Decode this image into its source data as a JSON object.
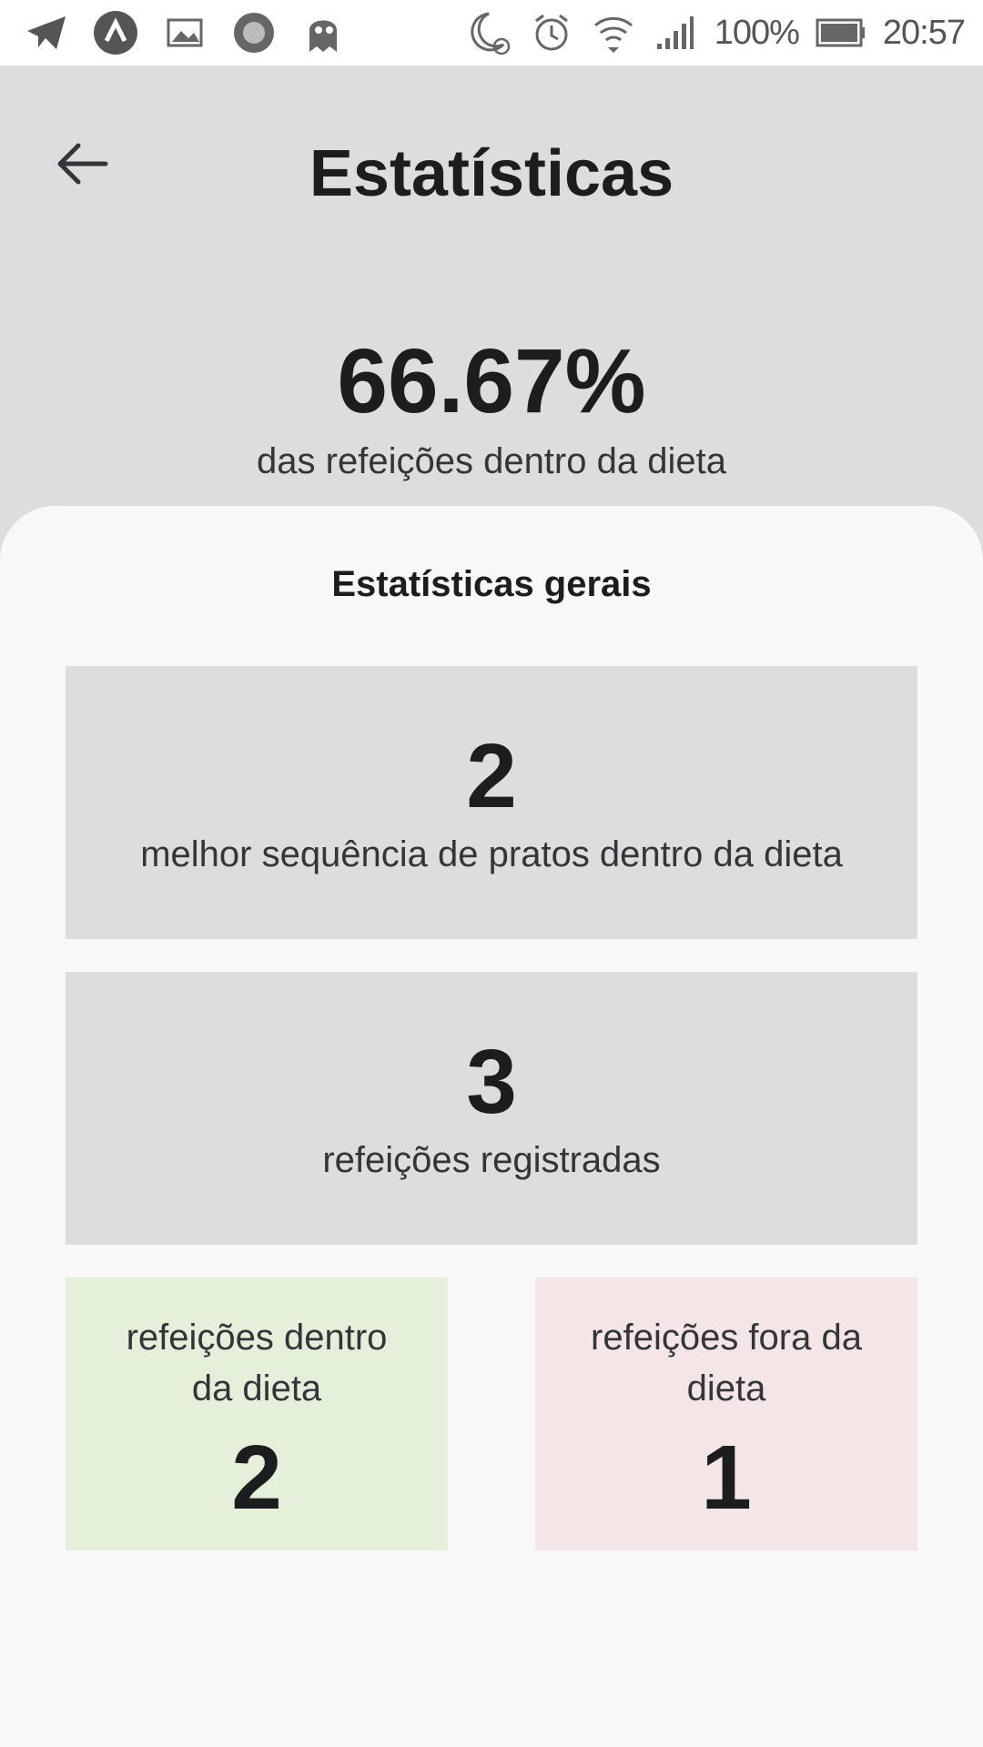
{
  "status_bar": {
    "battery": "100%",
    "time": "20:57"
  },
  "header": {
    "title": "Estatísticas",
    "percent": "66.67%",
    "percent_label": "das refeições dentro da dieta"
  },
  "stats": {
    "section_title": "Estatísticas gerais",
    "best_sequence": {
      "value": "2",
      "label": "melhor sequência de pratos dentro da dieta"
    },
    "registered": {
      "value": "3",
      "label": "refeições registradas"
    },
    "inside_diet": {
      "value": "2",
      "label": "refeições dentro da dieta",
      "color": "#e5f0db"
    },
    "outside_diet": {
      "value": "1",
      "label": "refeições fora da dieta",
      "color": "#f4e6e7"
    }
  },
  "colors": {
    "header_bg": "#dddde0",
    "sheet_bg": "#f8f8f8",
    "text": "#1b1d1e"
  },
  "icons": {
    "back": "arrow-left-icon"
  }
}
